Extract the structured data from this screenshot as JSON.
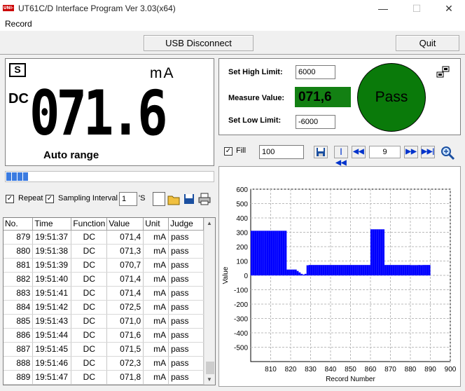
{
  "window": {
    "title": "UT61C/D Interface Program Ver 3.03(x64)",
    "minimize": "—",
    "maximize": "☐",
    "close": "✕"
  },
  "menu": {
    "record": "Record"
  },
  "buttons": {
    "usb": "USB Disconnect",
    "quit": "Quit"
  },
  "display": {
    "mode_badge": "S",
    "unit": "mA",
    "function": "DC",
    "reading": "071.6",
    "range": "Auto range",
    "progress_cells": 4
  },
  "limits": {
    "high_label": "Set High Limit:",
    "high_value": "6000",
    "measure_label": "Measure Value:",
    "measure_value": "071,6",
    "low_label": "Set Low Limit:",
    "low_value": "-6000",
    "judge": "Pass",
    "judge_color": "#0a7a0a"
  },
  "chart_controls": {
    "fill_label": "Fill",
    "fill_checked": true,
    "count": "100",
    "page": "9"
  },
  "sampling": {
    "repeat_label": "Repeat",
    "repeat_checked": true,
    "interval_checked": true,
    "interval_label": "Sampling Interval",
    "interval_value": "1",
    "interval_unit": "'S"
  },
  "table": {
    "headers": [
      "No.",
      "Time",
      "Function",
      "Value",
      "Unit",
      "Judge"
    ],
    "rows": [
      [
        "879",
        "19:51:37",
        "DC",
        "071,4",
        "mA",
        "pass"
      ],
      [
        "880",
        "19:51:38",
        "DC",
        "071,3",
        "mA",
        "pass"
      ],
      [
        "881",
        "19:51:39",
        "DC",
        "070,7",
        "mA",
        "pass"
      ],
      [
        "882",
        "19:51:40",
        "DC",
        "071,4",
        "mA",
        "pass"
      ],
      [
        "883",
        "19:51:41",
        "DC",
        "071,4",
        "mA",
        "pass"
      ],
      [
        "884",
        "19:51:42",
        "DC",
        "072,5",
        "mA",
        "pass"
      ],
      [
        "885",
        "19:51:43",
        "DC",
        "071,0",
        "mA",
        "pass"
      ],
      [
        "886",
        "19:51:44",
        "DC",
        "071,6",
        "mA",
        "pass"
      ],
      [
        "887",
        "19:51:45",
        "DC",
        "071,5",
        "mA",
        "pass"
      ],
      [
        "888",
        "19:51:46",
        "DC",
        "072,3",
        "mA",
        "pass"
      ],
      [
        "889",
        "19:51:47",
        "DC",
        "071,8",
        "mA",
        "pass"
      ]
    ]
  },
  "chart_data": {
    "type": "bar",
    "xlabel": "Record Number",
    "ylabel": "Value",
    "xlim": [
      800,
      900
    ],
    "ylim": [
      -600,
      600
    ],
    "xticks": [
      810,
      820,
      830,
      840,
      850,
      860,
      870,
      880,
      890,
      900
    ],
    "yticks": [
      600,
      500,
      400,
      300,
      200,
      100,
      0,
      -100,
      -200,
      -300,
      -400,
      -500
    ],
    "grid": true,
    "color": "#0000ff",
    "x": [
      800,
      801,
      802,
      803,
      804,
      805,
      806,
      807,
      808,
      809,
      810,
      811,
      812,
      813,
      814,
      815,
      816,
      817,
      818,
      819,
      820,
      821,
      822,
      823,
      824,
      825,
      826,
      827,
      828,
      829,
      830,
      831,
      832,
      833,
      834,
      835,
      836,
      837,
      838,
      839,
      840,
      841,
      842,
      843,
      844,
      845,
      846,
      847,
      848,
      849,
      850,
      851,
      852,
      853,
      854,
      855,
      856,
      857,
      858,
      859,
      860,
      861,
      862,
      863,
      864,
      865,
      866,
      867,
      868,
      869,
      870,
      871,
      872,
      873,
      874,
      875,
      876,
      877,
      878,
      879,
      880,
      881,
      882,
      883,
      884,
      885,
      886,
      887,
      888,
      889
    ],
    "values": [
      310,
      310,
      310,
      310,
      310,
      310,
      310,
      310,
      310,
      310,
      310,
      310,
      310,
      310,
      310,
      310,
      310,
      310,
      40,
      40,
      40,
      40,
      40,
      30,
      20,
      10,
      5,
      10,
      70,
      72,
      72,
      72,
      72,
      72,
      72,
      72,
      72,
      72,
      72,
      72,
      72,
      72,
      72,
      72,
      72,
      72,
      72,
      72,
      72,
      72,
      72,
      72,
      72,
      72,
      72,
      72,
      72,
      72,
      72,
      72,
      320,
      320,
      320,
      320,
      320,
      320,
      320,
      72,
      72,
      72,
      72,
      72,
      72,
      72,
      72,
      72,
      72,
      72,
      72,
      72,
      71,
      71,
      71,
      71,
      72,
      71,
      72,
      72,
      72,
      72
    ]
  }
}
